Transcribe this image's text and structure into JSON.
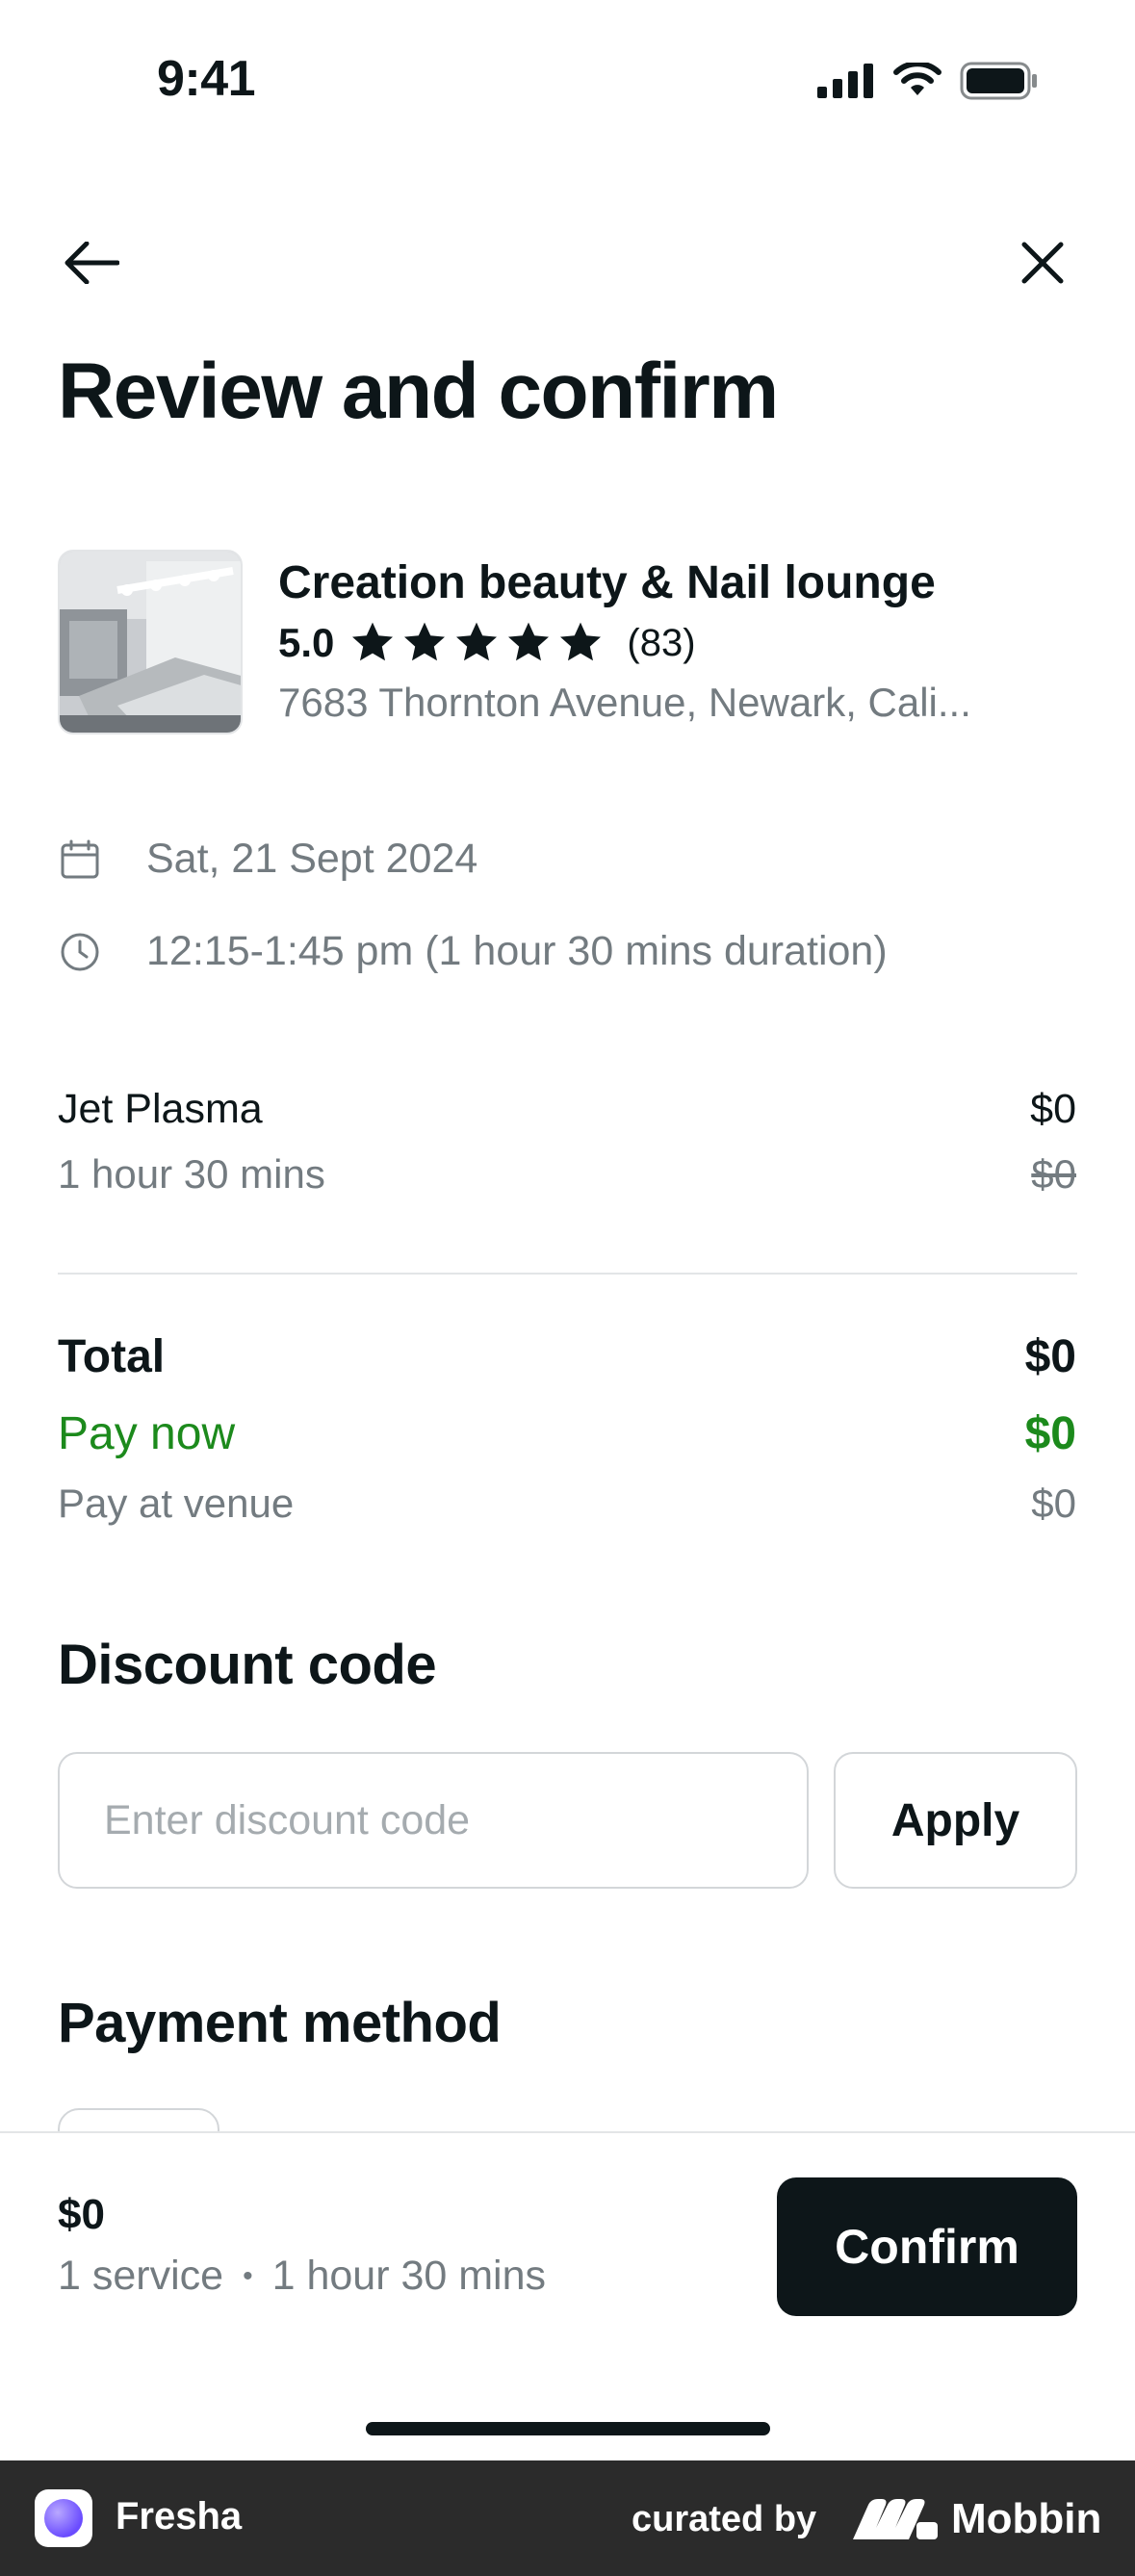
{
  "status_bar": {
    "time": "9:41"
  },
  "header": {
    "title": "Review and confirm"
  },
  "venue": {
    "name": "Creation beauty & Nail lounge",
    "rating": "5.0",
    "stars": 5,
    "review_count": "(83)",
    "address": "7683 Thornton Avenue, Newark, Cali..."
  },
  "booking": {
    "date": "Sat, 21 Sept 2024",
    "time": "12:15-1:45 pm (1 hour 30 mins duration)"
  },
  "service": {
    "name": "Jet Plasma",
    "duration": "1 hour 30 mins",
    "price": "$0",
    "original_price": "$0"
  },
  "totals": {
    "total_label": "Total",
    "total_value": "$0",
    "pay_now_label": "Pay now",
    "pay_now_value": "$0",
    "pay_at_venue_label": "Pay at venue",
    "pay_at_venue_value": "$0"
  },
  "discount": {
    "title": "Discount code",
    "placeholder": "Enter discount code",
    "value": "",
    "apply_label": "Apply"
  },
  "payment": {
    "title": "Payment method"
  },
  "footer": {
    "price": "$0",
    "services": "1 service",
    "duration": "1 hour 30 mins",
    "confirm_label": "Confirm"
  },
  "watermark": {
    "app_name": "Fresha",
    "curated_by": "curated by",
    "brand": "Mobbin"
  },
  "colors": {
    "text_primary": "#0d1619",
    "text_secondary": "#737b80",
    "accent_green": "#1c8a1c",
    "button_dark": "#0d1619",
    "border": "#d3d6d9"
  },
  "icons": [
    "signal-icon",
    "wifi-icon",
    "battery-icon",
    "back-arrow-icon",
    "close-icon",
    "star-icon",
    "calendar-icon",
    "clock-icon"
  ]
}
